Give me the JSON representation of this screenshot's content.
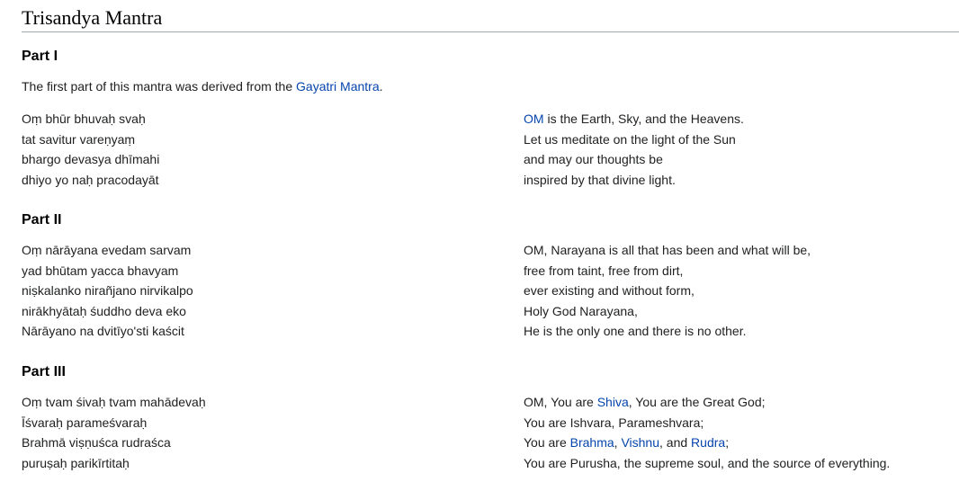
{
  "title": "Trisandya Mantra",
  "sections": [
    {
      "heading": "Part I",
      "intro": {
        "before": "The first part of this mantra was derived from the ",
        "link": "Gayatri Mantra",
        "after": "."
      },
      "sanskrit": [
        "Oṃ bhūr bhuvaḥ svaḥ",
        "tat savitur vareṇyaṃ",
        "bhargo devasya dhīmahi",
        "dhiyo yo naḥ pracodayāt"
      ],
      "translation": {
        "line1_link": "OM",
        "line1_rest": " is the Earth, Sky, and the Heavens.",
        "line2": "Let us meditate on the light of the Sun",
        "line3": "and may our thoughts be",
        "line4": "inspired by that divine light."
      }
    },
    {
      "heading": "Part II",
      "sanskrit": [
        "Oṃ nārāyana evedam sarvam",
        "yad bhūtam yacca bhavyam",
        "niṣkalanko nirañjano nirvikalpo",
        "nirākhyātaḥ śuddho deva eko",
        "Nārāyano na dvitīyo'sti kaścit"
      ],
      "translation": [
        "OM, Narayana is all that has been and what will be,",
        "free from taint, free from dirt,",
        "ever existing and without form,",
        "Holy God Narayana,",
        "He is the only one and there is no other."
      ]
    },
    {
      "heading": "Part III",
      "sanskrit": [
        "Oṃ tvam śivaḥ tvam mahādevaḥ",
        "Īśvaraḥ parameśvaraḥ",
        "Brahmā viṣṇuśca rudraśca",
        "puruṣaḥ parikīrtitaḥ"
      ],
      "translation": {
        "line1_before": "OM, You are ",
        "line1_link": "Shiva",
        "line1_after": ", You are the Great God;",
        "line2": "You are Ishvara, Parameshvara;",
        "line3_before": "You are ",
        "line3_link1": "Brahma",
        "line3_sep1": ", ",
        "line3_link2": "Vishnu",
        "line3_sep2": ", and ",
        "line3_link3": "Rudra",
        "line3_after": ";",
        "line4": "You are Purusha, the supreme soul, and the source of everything."
      }
    }
  ],
  "colors": {
    "link": "#0645ad",
    "text": "#202122",
    "rule": "#a2a9b1"
  }
}
